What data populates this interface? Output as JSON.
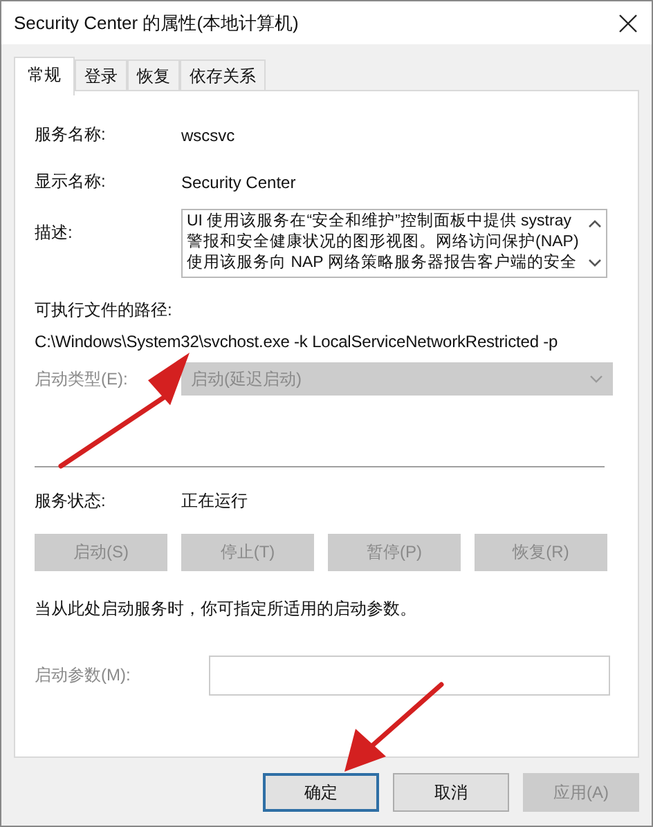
{
  "window": {
    "title": "Security Center 的属性(本地计算机)"
  },
  "tabs": [
    {
      "label": "常规",
      "selected": true
    },
    {
      "label": "登录",
      "selected": false
    },
    {
      "label": "恢复",
      "selected": false
    },
    {
      "label": "依存关系",
      "selected": false
    }
  ],
  "service_name": {
    "label": "服务名称:",
    "value": "wscsvc"
  },
  "display_name": {
    "label": "显示名称:",
    "value": "Security Center"
  },
  "description": {
    "label": "描述:",
    "lines": [
      "UI 使用该服务在“安全和维护”控制面板中提供 systray",
      "警报和安全健康状况的图形视图。网络访问保护(NAP)",
      "使用该服务向 NAP 网络策略服务器报告客户端的安全"
    ]
  },
  "executable_path": {
    "label": "可执行文件的路径:",
    "value": "C:\\Windows\\System32\\svchost.exe -k LocalServiceNetworkRestricted -p"
  },
  "startup_type": {
    "label": "启动类型(E):",
    "value": "启动(延迟启动)",
    "disabled": true
  },
  "service_status": {
    "label": "服务状态:",
    "value": "正在运行"
  },
  "control_buttons": [
    {
      "label": "启动(S)",
      "disabled": true
    },
    {
      "label": "停止(T)",
      "disabled": true
    },
    {
      "label": "暂停(P)",
      "disabled": true
    },
    {
      "label": "恢复(R)",
      "disabled": true
    }
  ],
  "hint": "当从此处启动服务时，你可指定所适用的启动参数。",
  "start_parameters": {
    "label": "启动参数(M):",
    "disabled": true
  },
  "dialog_buttons": [
    {
      "label": "确定",
      "default": true,
      "disabled": false
    },
    {
      "label": "取消",
      "default": false,
      "disabled": false
    },
    {
      "label": "应用(A)",
      "default": false,
      "disabled": true
    }
  ]
}
